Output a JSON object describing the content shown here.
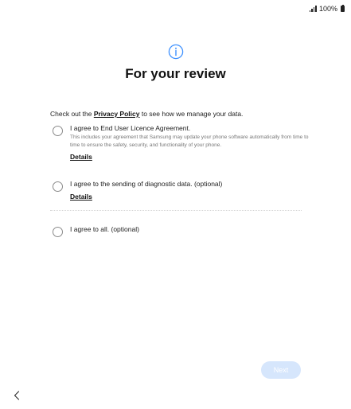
{
  "status_bar": {
    "battery": "100%",
    "icons": [
      "signal-icon",
      "battery-icon"
    ]
  },
  "header": {
    "icon": "info-icon",
    "title": "For your review"
  },
  "intro": {
    "prefix": "Check out the ",
    "link": "Privacy Policy",
    "suffix": " to see how we manage your data."
  },
  "options": [
    {
      "label": "I agree to End User Licence Agreement.",
      "description": "This includes your agreement that Samsung may update your phone software automatically from time to time to ensure the safety, security, and functionality of your phone.",
      "link": "Details",
      "checked": false
    },
    {
      "label": "I agree to the sending of diagnostic data. (optional)",
      "link": "Details",
      "checked": false
    },
    {
      "label": "I agree to all. (optional)",
      "checked": false
    }
  ],
  "footer": {
    "next_label": "Next",
    "next_enabled": false,
    "back_icon": "chevron-left-icon"
  },
  "colors": {
    "accent_disabled": "#d6e6fc",
    "info_icon": "#3e91ff"
  }
}
